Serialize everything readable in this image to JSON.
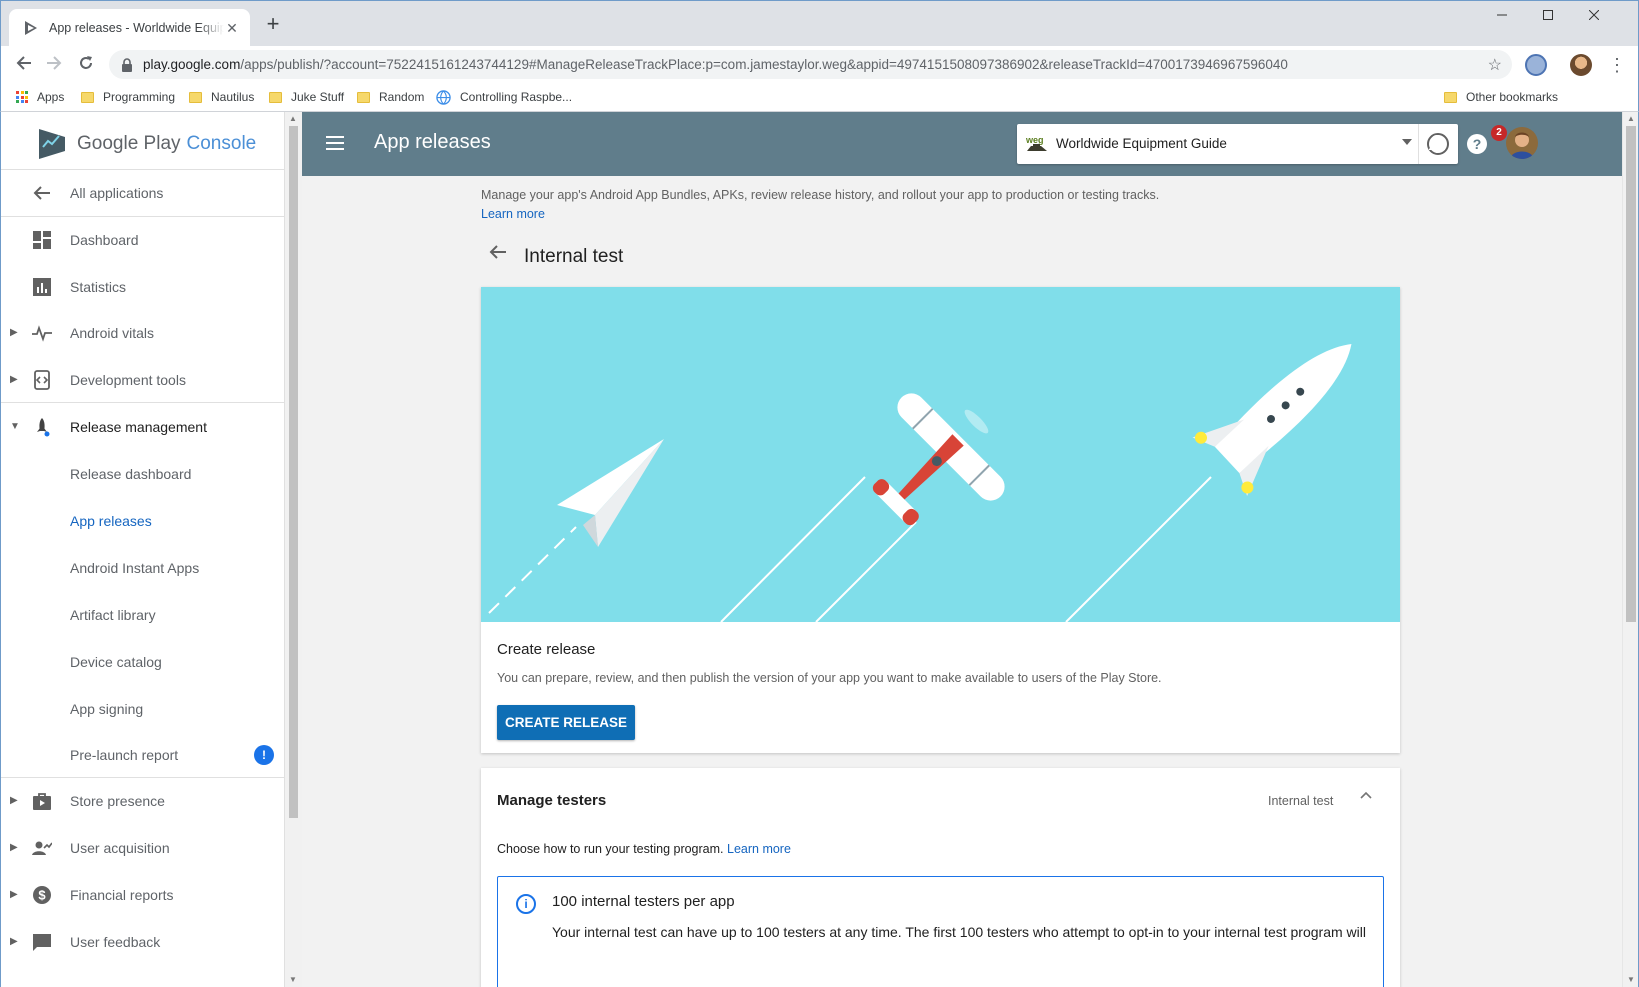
{
  "browser": {
    "tab_title": "App releases - Worldwide Equipment Guide",
    "close_glyph": "✕",
    "new_tab_glyph": "+",
    "url_host": "play.google.com",
    "url_path": "/apps/publish/?account=7522415161243744129#ManageReleaseTrackPlace:p=com.jamestaylor.weg&appid=4974151508097386902&releaseTrackId=4700173946967596040",
    "bookmarks": [
      "Apps",
      "Programming",
      "Nautilus",
      "Juke Stuff",
      "Random",
      "Controlling Raspbe...",
      "Other bookmarks"
    ]
  },
  "sidebar": {
    "logo_text": "Google Play",
    "logo_console": "Console",
    "items": [
      {
        "label": "All applications",
        "icon": "back-arrow-icon"
      },
      {
        "label": "Dashboard",
        "icon": "dashboard-icon"
      },
      {
        "label": "Statistics",
        "icon": "statistics-icon"
      },
      {
        "label": "Android vitals",
        "icon": "vitals-icon"
      },
      {
        "label": "Development tools",
        "icon": "dev-tools-icon"
      },
      {
        "label": "Release management",
        "icon": "rocket-icon"
      },
      {
        "label": "Release dashboard"
      },
      {
        "label": "App releases"
      },
      {
        "label": "Android Instant Apps"
      },
      {
        "label": "Artifact library"
      },
      {
        "label": "Device catalog"
      },
      {
        "label": "App signing"
      },
      {
        "label": "Pre-launch report"
      },
      {
        "label": "Store presence",
        "icon": "store-icon"
      },
      {
        "label": "User acquisition",
        "icon": "user-acquisition-icon"
      },
      {
        "label": "Financial reports",
        "icon": "dollar-icon"
      },
      {
        "label": "User feedback",
        "icon": "feedback-icon"
      }
    ],
    "prelaunch_badge": "!"
  },
  "header": {
    "title": "App releases",
    "app_name": "Worldwide Equipment Guide",
    "notification_count": "2",
    "info_glyph": "i"
  },
  "main": {
    "description": "Manage your app's Android App Bundles, APKs, review release history, and rollout your app to production or testing tracks.",
    "learn_more": "Learn more",
    "page_title": "Internal test",
    "create_release": {
      "title": "Create release",
      "body": "You can prepare, review, and then publish the version of your app you want to make available to users of the Play Store.",
      "button": "CREATE RELEASE"
    },
    "manage_testers": {
      "title": "Manage testers",
      "track": "Internal test",
      "choose": "Choose how to run your testing program.",
      "learn_more": "Learn more",
      "info_title": "100 internal testers per app",
      "info_body": "Your internal test can have up to 100 testers at any time. The first 100 testers who attempt to opt-in to your internal test program will"
    }
  },
  "colors": {
    "header_bg": "#607d8b",
    "banner_bg": "#80deea",
    "primary_button": "#0f6eb5",
    "link": "#1565c0"
  }
}
